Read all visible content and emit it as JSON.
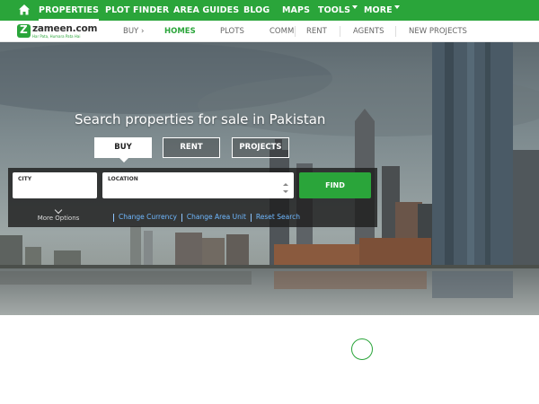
{
  "topnav": {
    "items": [
      {
        "label": "PROPERTIES"
      },
      {
        "label": "PLOT FINDER"
      },
      {
        "label": "AREA GUIDES"
      },
      {
        "label": "BLOG"
      },
      {
        "label": "MAPS"
      },
      {
        "label": "TOOLS"
      },
      {
        "label": "MORE"
      }
    ]
  },
  "brand": {
    "name": "zameen.com",
    "tagline": "Har Pata, Humara Pata Hai"
  },
  "subnav": {
    "items": [
      {
        "label": "BUY"
      },
      {
        "label": "HOMES"
      },
      {
        "label": "PLOTS"
      },
      {
        "label": "COMM"
      },
      {
        "label": "RENT"
      },
      {
        "label": "AGENTS"
      },
      {
        "label": "NEW PROJECTS"
      }
    ],
    "back_arrow": "›"
  },
  "hero": {
    "title": "Search properties for sale in Pakistan",
    "tabs": [
      {
        "label": "BUY"
      },
      {
        "label": "RENT"
      },
      {
        "label": "PROJECTS"
      }
    ]
  },
  "search": {
    "city_label": "CITY",
    "city_value": "",
    "location_label": "LOCATION",
    "location_value": "",
    "find_label": "FIND",
    "more_options": "More Options",
    "links": [
      "Change Currency",
      "Change Area Unit",
      "Reset Search"
    ]
  },
  "colors": {
    "brand_green": "#2aa53a",
    "link_blue": "#6fb8ff"
  }
}
